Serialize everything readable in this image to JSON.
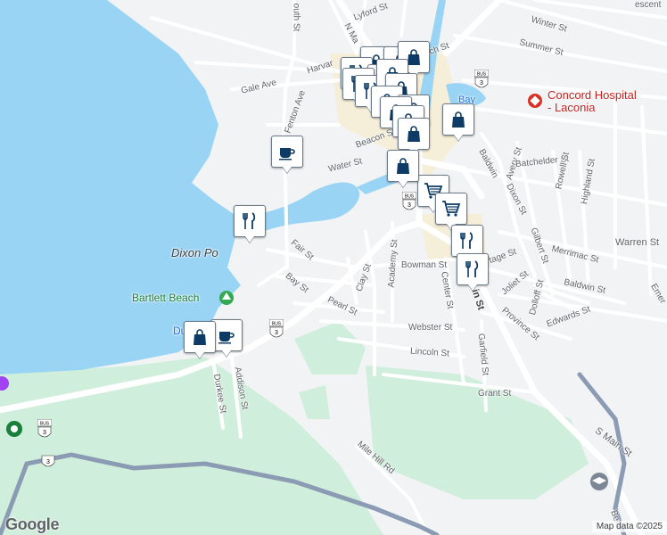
{
  "map": {
    "colors": {
      "water": "#9ad4f5",
      "land": "#f1f3f4",
      "park": "#cfeedb",
      "road": "#ffffff",
      "highway": "#8a9bb3",
      "downtown": "#f5eed8"
    },
    "streets": {
      "lyford": "Lyford St",
      "winter": "Winter St",
      "summer": "Summer St",
      "church": "rch St",
      "crescent": "escent",
      "gale": "Gale Ave",
      "fenton": "Fenton Ave",
      "harvard": "Harvar",
      "water": "Water St",
      "beacon": "Beacon St",
      "nmain": "N Ma",
      "south": "outh St",
      "avery": "Avery St",
      "batchelder": "Batchelder St",
      "rowell": "Rowell St",
      "highland": "Highland St",
      "baldwin1": "Baldwin",
      "dixon": "Dixon St",
      "gilbert": "Gilbert St",
      "merrimac": "Merrimac St",
      "warren": "Warren St",
      "fair": "Fair St",
      "bay": "Bay St",
      "clay": "Clay St",
      "academy": "Academy St",
      "bowman": "Bowman St",
      "center": "Center St",
      "tage": "tage St",
      "joliet": "Joliet St",
      "dolloff": "Dolloff St",
      "baldwin2": "Baldwin St",
      "emer": "Emer",
      "pearl": "Pearl St",
      "webster": "Webster St",
      "province": "Province St",
      "edwards": "Edwards St",
      "lincoln": "Lincoln St",
      "garfield": "Garfield St",
      "grant": "Grant St",
      "addison": "Addison St",
      "durkee": "Durkee St",
      "smain": "S Main St",
      "millhill": "Mile Hill Rd",
      "mainst": "in St",
      "baypart": "Bay",
      "belm": "Belm",
      "du": "Du"
    },
    "places": {
      "dixon_point": "Dixon Po",
      "bartlett": "Bartlett Beach",
      "hospital_l1": "Concord Hospital",
      "hospital_l2": "- Laconia"
    },
    "shields": {
      "bus": "BUS",
      "num": "3"
    },
    "logo": "Google",
    "attribution": "Map data ©2025"
  },
  "markers": [
    {
      "type": "shopping-bag-icon"
    },
    {
      "type": "restaurant-icon"
    },
    {
      "type": "shopping-bag-icon"
    },
    {
      "type": "restaurant-icon"
    },
    {
      "type": "shopping-bag-icon"
    },
    {
      "type": "shopping-bag-icon"
    },
    {
      "type": "restaurant-icon"
    },
    {
      "type": "shopping-bag-icon"
    },
    {
      "type": "shopping-bag-icon"
    },
    {
      "type": "shopping-bag-icon"
    },
    {
      "type": "shopping-bag-icon"
    },
    {
      "type": "shopping-bag-icon"
    },
    {
      "type": "shopping-bag-icon"
    },
    {
      "type": "coffee-icon"
    },
    {
      "type": "shopping-bag-icon"
    },
    {
      "type": "shopping-bag-icon"
    },
    {
      "type": "shopping-cart-icon"
    },
    {
      "type": "shopping-cart-icon"
    },
    {
      "type": "restaurant-icon"
    },
    {
      "type": "restaurant-icon"
    },
    {
      "type": "shopping-bag-icon"
    },
    {
      "type": "coffee-icon"
    },
    {
      "type": "shopping-bag-icon"
    },
    {
      "type": "restaurant-icon"
    }
  ]
}
